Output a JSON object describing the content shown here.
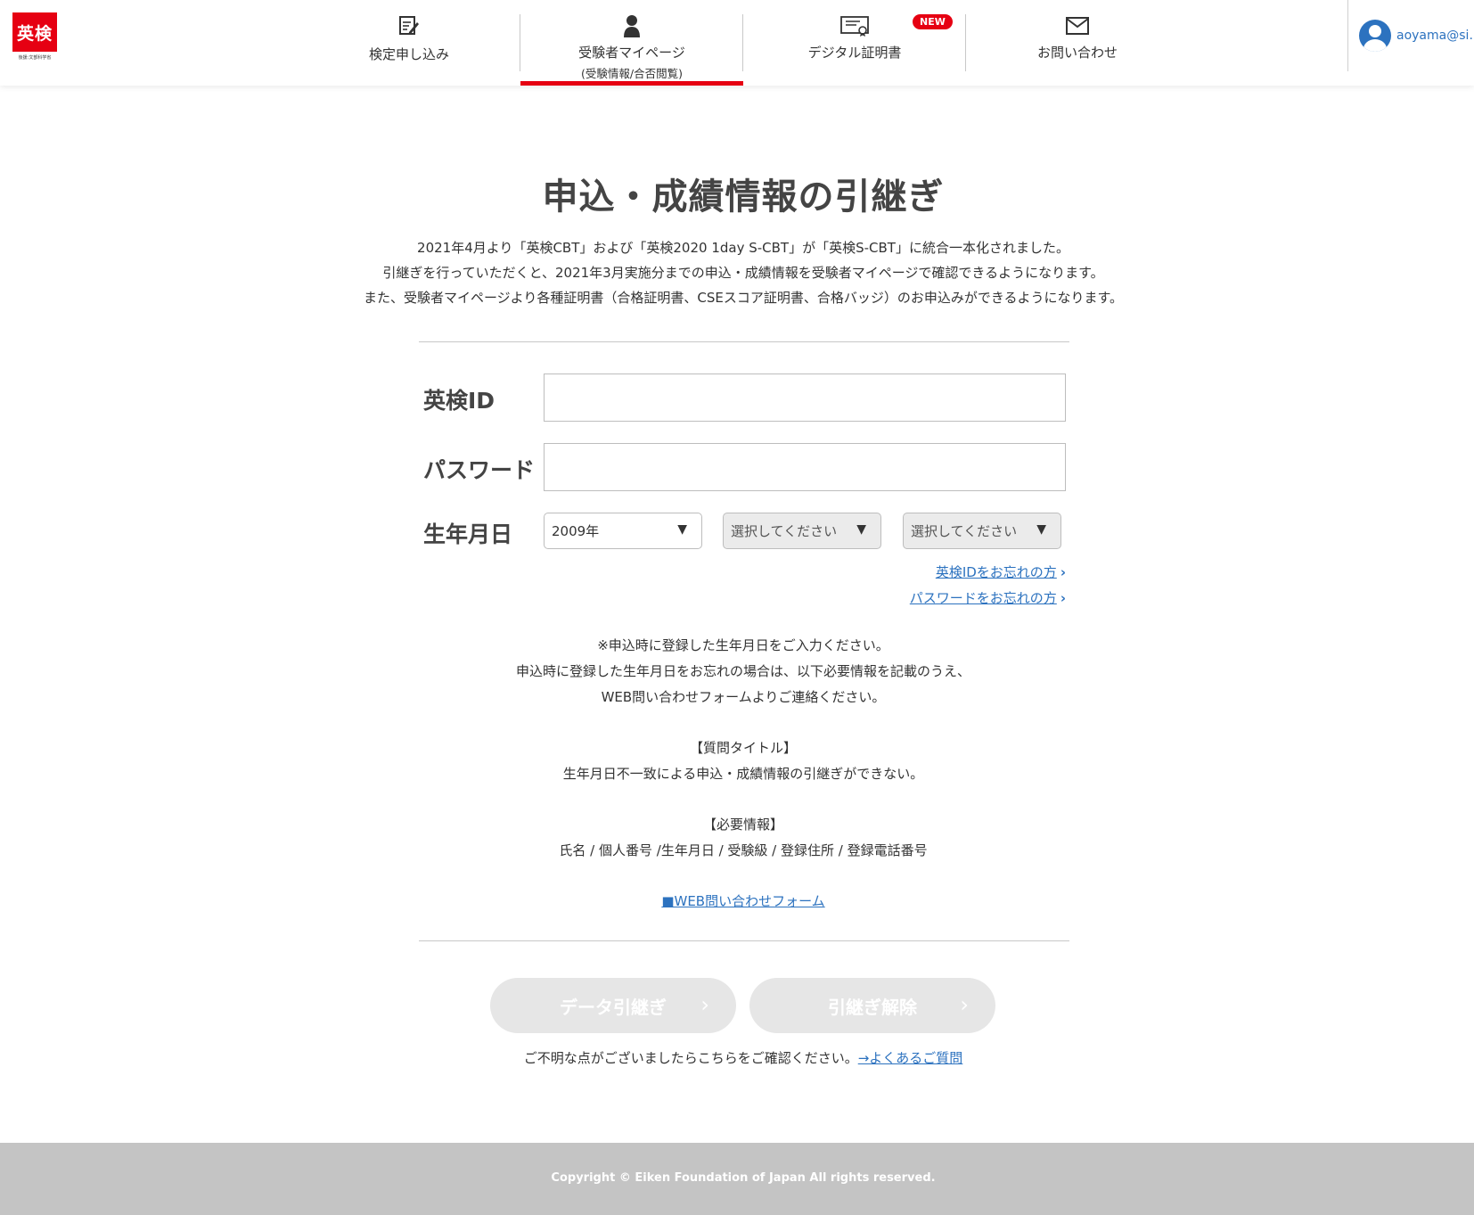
{
  "logo": {
    "text": "英検",
    "sub": "後援:文部科学省"
  },
  "nav": [
    {
      "label": "検定申し込み",
      "sub": ""
    },
    {
      "label": "受験者マイページ",
      "sub": "(受験情報/合否閲覧)"
    },
    {
      "label": "デジタル証明書",
      "sub": "",
      "badge": "NEW"
    },
    {
      "label": "お問い合わせ",
      "sub": ""
    }
  ],
  "user": {
    "email": "aoyama@si…"
  },
  "page": {
    "title": "申込・成績情報の引継ぎ",
    "intro": [
      "2021年4月より「英検CBT」および「英検2020 1day S-CBT」が「英検S-CBT」に統合一本化されました。",
      "引継ぎを行っていただくと、2021年3月実施分までの申込・成績情報を受験者マイページで確認できるようになります。",
      "また、受験者マイページより各種証明書（合格証明書、CSEスコア証明書、合格バッジ）のお申込みができるようになります。"
    ]
  },
  "form": {
    "eiken_id_label": "英検ID",
    "eiken_id_value": "",
    "password_label": "パスワード",
    "password_value": "",
    "birth_label": "生年月日",
    "birth_year": "2009年",
    "birth_month": "選択してください",
    "birth_day": "選択してください",
    "forgot_id": "英検IDをお忘れの方",
    "forgot_password": "パスワードをお忘れの方"
  },
  "notes": {
    "lines1": [
      "※申込時に登録した生年月日をご入力ください。",
      "申込時に登録した生年月日をお忘れの場合は、以下必要情報を記載のうえ、",
      "WEB問い合わせフォームよりご連絡ください。"
    ],
    "title_heading": "【質問タイトル】",
    "title_text": "生年月日不一致による申込・成績情報の引継ぎができない。",
    "info_heading": "【必要情報】",
    "info_text": "氏名 / 個人番号 /生年月日 / 受験級 / 登録住所 / 登録電話番号",
    "web_form_link": "■WEB問い合わせフォーム"
  },
  "buttons": {
    "transfer": "データ引継ぎ",
    "cancel": "引継ぎ解除"
  },
  "faq": {
    "text": "ご不明な点がございましたらこちらをご確認ください。",
    "link": "→よくあるご質問"
  },
  "footer": {
    "copyright": "Copyright © Eiken Foundation of Japan All rights reserved."
  }
}
